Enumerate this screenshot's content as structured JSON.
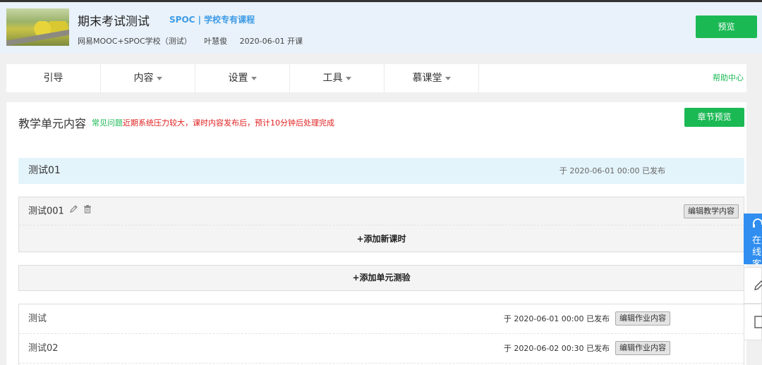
{
  "header": {
    "course_title": "期末考试测试",
    "course_tag": "SPOC | 学校专有课程",
    "school": "网易MOOC+SPOC学校（测试）",
    "teacher": "叶慧俊",
    "start": "2020-06-01 开课",
    "preview_label": "预览"
  },
  "nav": {
    "items": [
      {
        "label": "引导",
        "dropdown": false
      },
      {
        "label": "内容",
        "dropdown": true
      },
      {
        "label": "设置",
        "dropdown": true
      },
      {
        "label": "工具",
        "dropdown": true
      },
      {
        "label": "慕课堂",
        "dropdown": true
      }
    ],
    "help": "帮助中心"
  },
  "main": {
    "title": "教学单元内容",
    "notice_green": "常见问题",
    "notice_red": "近期系统压力较大，课时内容发布后，预计10分钟后处理完成",
    "chapter_preview": "章节预览",
    "unit": {
      "name": "测试01",
      "status": "于  2020-06-01 00:00 已发布"
    },
    "lesson": {
      "name": "测试001",
      "edit_label": "编辑教学内容",
      "add_lesson": "+添加新课时"
    },
    "add_quiz": "+添加单元测验",
    "homework": [
      {
        "name": "测试",
        "status": "于  2020-06-01 00:00 已发布",
        "edit_label": "编辑作业内容"
      },
      {
        "name": "测试02",
        "status": "于  2020-06-02 00:30 已发布",
        "edit_label": "编辑作业内容"
      }
    ]
  },
  "side": {
    "online_label": "在线客服"
  },
  "colors": {
    "accent_green": "#1bb954",
    "tag_blue": "#3e9be6",
    "notice_red": "#e02020",
    "unit_bar": "#e4f4fb",
    "side_blue": "#2f8ef0"
  }
}
